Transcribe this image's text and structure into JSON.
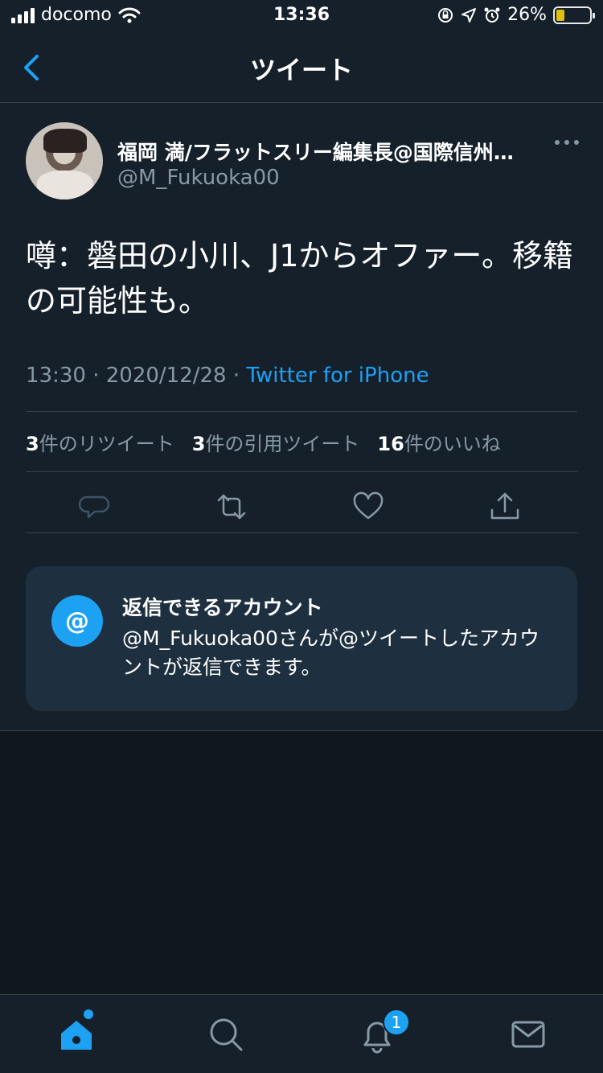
{
  "status_bar": {
    "carrier": "docomo",
    "time": "13:36",
    "battery_percent": "26%",
    "battery_level": 0.26,
    "icons": [
      "signal-icon",
      "wifi-icon",
      "rotation-lock-icon",
      "location-icon",
      "alarm-icon",
      "battery-icon"
    ]
  },
  "nav": {
    "title": "ツイート",
    "back_icon": "chevron-left-icon"
  },
  "author": {
    "name": "福岡 満/フラットスリー編集長@国際信州…",
    "handle": "@M_Fukuoka00"
  },
  "tweet": {
    "text": "噂：磐田の小川、J1からオファー。移籍の可能性も。",
    "time": "13:30",
    "date": "2020/12/28",
    "separator": "·",
    "source": "Twitter for iPhone"
  },
  "stats": {
    "retweets_count": "3",
    "retweets_label": "件のリツイート",
    "quotes_count": "3",
    "quotes_label": "件の引用ツイート",
    "likes_count": "16",
    "likes_label": "件のいいね"
  },
  "reply_settings": {
    "icon_text": "@",
    "title": "返信できるアカウント",
    "description": "@M_Fukuoka00さんが@ツイートしたアカウントが返信できます。"
  },
  "tabbar": {
    "notification_badge": "1"
  },
  "colors": {
    "background": "#15202b",
    "accent": "#1da1f2",
    "secondary_text": "#8899a6",
    "divider": "#38444d"
  }
}
